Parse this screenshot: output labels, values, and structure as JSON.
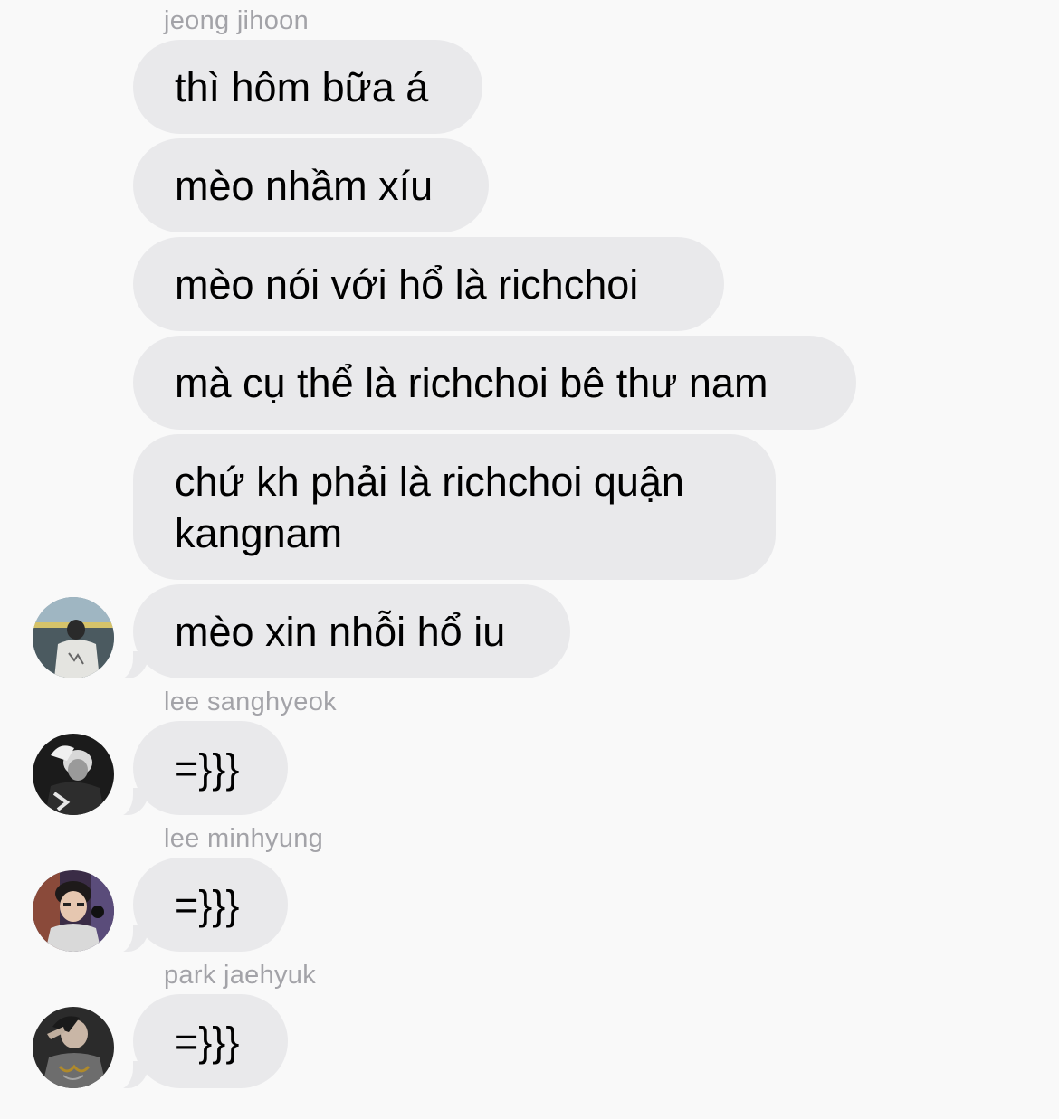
{
  "messages": [
    {
      "sender": "jeong jihoon",
      "bubbles": [
        "thì hôm bữa á",
        "mèo nhầm xíu",
        "mèo nói với hổ là richchoi",
        "mà cụ thể là richchoi bê thư nam",
        "chứ kh phải là richchoi quận kangnam",
        "mèo xin nhỗi hổ iu"
      ]
    },
    {
      "sender": "lee sanghyeok",
      "bubbles": [
        "=}}}"
      ]
    },
    {
      "sender": "lee minhyung",
      "bubbles": [
        "=}}}"
      ]
    },
    {
      "sender": "park jaehyuk",
      "bubbles": [
        "=}}}"
      ]
    }
  ],
  "colors": {
    "background": "#f9f9f9",
    "bubble": "#e9e9eb",
    "sender_name": "#a3a3a8",
    "message_text": "#000000"
  }
}
